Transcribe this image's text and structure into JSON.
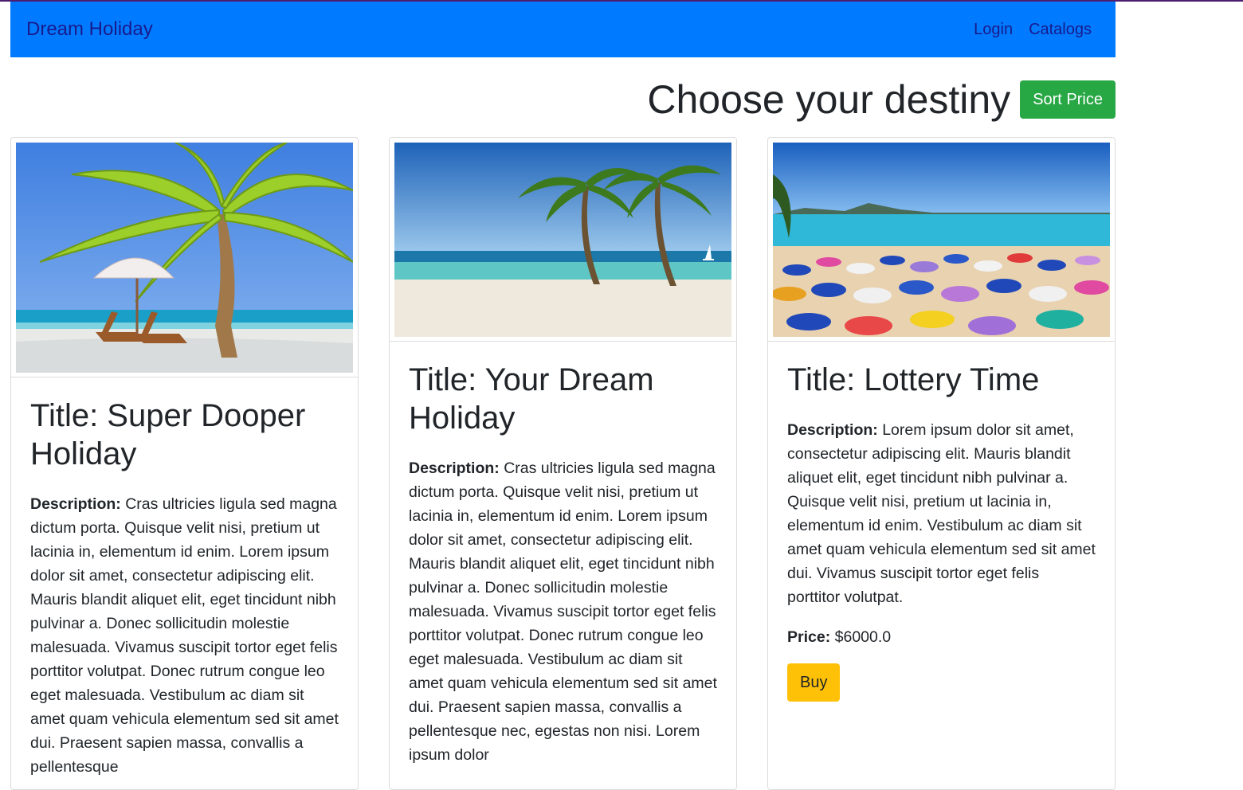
{
  "nav": {
    "brand": "Dream Holiday",
    "links": [
      "Login",
      "Catalogs"
    ]
  },
  "header": {
    "title": "Choose your destiny",
    "sort_button": "Sort Price"
  },
  "colors": {
    "navbar": "#007bff",
    "sort_button": "#28a745",
    "buy_button": "#ffc107"
  },
  "cards": [
    {
      "title": "Title: Super Dooper Holiday",
      "description_label": "Description:",
      "description": "Cras ultricies ligula sed magna dictum porta. Quisque velit nisi, pretium ut lacinia in, elementum id enim. Lorem ipsum dolor sit amet, consectetur adipiscing elit. Mauris blandit aliquet elit, eget tincidunt nibh pulvinar a. Donec sollicitudin molestie malesuada. Vivamus suscipit tortor eget felis porttitor volutpat. Donec rutrum congue leo eget malesuada. Vestibulum ac diam sit amet quam vehicula elementum sed sit amet dui. Praesent sapien massa, convallis a pellentesque",
      "image": "beach-palm-umbrella-loungers"
    },
    {
      "title": "Title: Your Dream Holiday",
      "description_label": "Description:",
      "description": "Cras ultricies ligula sed magna dictum porta. Quisque velit nisi, pretium ut lacinia in, elementum id enim. Lorem ipsum dolor sit amet, consectetur adipiscing elit. Mauris blandit aliquet elit, eget tincidunt nibh pulvinar a. Donec sollicitudin molestie malesuada. Vivamus suscipit tortor eget felis porttitor volutpat. Donec rutrum congue leo eget malesuada. Vestibulum ac diam sit amet quam vehicula elementum sed sit amet dui. Praesent sapien massa, convallis a pellentesque nec, egestas non nisi. Lorem ipsum dolor",
      "image": "beach-two-palms-sailboat"
    },
    {
      "title": "Title: Lottery Time",
      "description_label": "Description:",
      "description": "Lorem ipsum dolor sit amet, consectetur adipiscing elit. Mauris blandit aliquet elit, eget tincidunt nibh pulvinar a. Quisque velit nisi, pretium ut lacinia in, elementum id enim. Vestibulum ac diam sit amet quam vehicula elementum sed sit amet dui. Vivamus suscipit tortor eget felis porttitor volutpat.",
      "price_label": "Price:",
      "price": "$6000.0",
      "buy_button": "Buy",
      "image": "crowded-beach-umbrellas"
    }
  ]
}
